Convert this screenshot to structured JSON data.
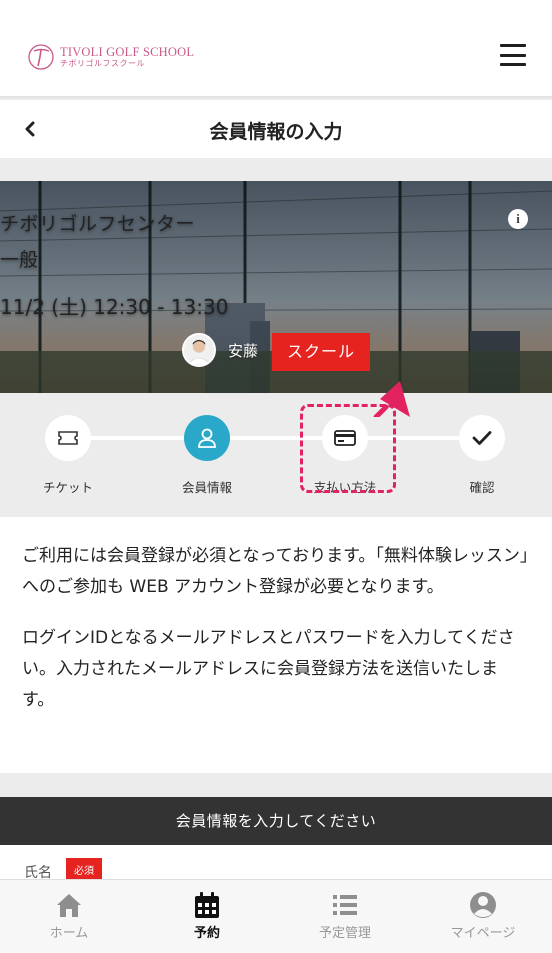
{
  "header": {
    "logo_title": "TIVOLI GOLF SCHOOL",
    "logo_sub": "チボリゴルフスクール",
    "menu_icon": "hamburger-menu-icon"
  },
  "titlebar": {
    "title": "会員情報の入力",
    "back_icon": "chevron-left-icon"
  },
  "hero": {
    "center_name": "チボリゴルフセンター",
    "lesson_type": "一般",
    "datetime": "11/2 (土) 12:30 - 13:30",
    "instructor_name": "安藤",
    "badge": "スクール",
    "info_icon": "i"
  },
  "stepper": {
    "steps": [
      {
        "label": "チケット",
        "icon": "ticket-icon",
        "active": false
      },
      {
        "label": "会員情報",
        "icon": "user-icon",
        "active": true
      },
      {
        "label": "支払い方法",
        "icon": "credit-card-icon",
        "active": false
      },
      {
        "label": "確認",
        "icon": "check-icon",
        "active": false
      }
    ]
  },
  "description": {
    "paragraph1": "ご利用には会員登録が必須となっております。「無料体験レッスン」へのご参加も WEB アカウント登録が必要となります。",
    "paragraph2": "ログインIDとなるメールアドレスとパスワードを入力してください。入力されたメールアドレスに会員登録方法を送信いたします。"
  },
  "form": {
    "header": "会員情報を入力してください",
    "name_label": "氏名",
    "required": "必須"
  },
  "bottom_nav": {
    "items": [
      {
        "label": "ホーム",
        "icon": "home-icon"
      },
      {
        "label": "予約",
        "icon": "calendar-icon"
      },
      {
        "label": "予定管理",
        "icon": "list-icon"
      },
      {
        "label": "マイページ",
        "icon": "user-circle-icon"
      }
    ],
    "active": "予約"
  },
  "colors": {
    "accent_red": "#e52420",
    "step_active": "#2aa8c9",
    "highlight": "#e2235f",
    "logo_pink": "#c85a8a"
  }
}
